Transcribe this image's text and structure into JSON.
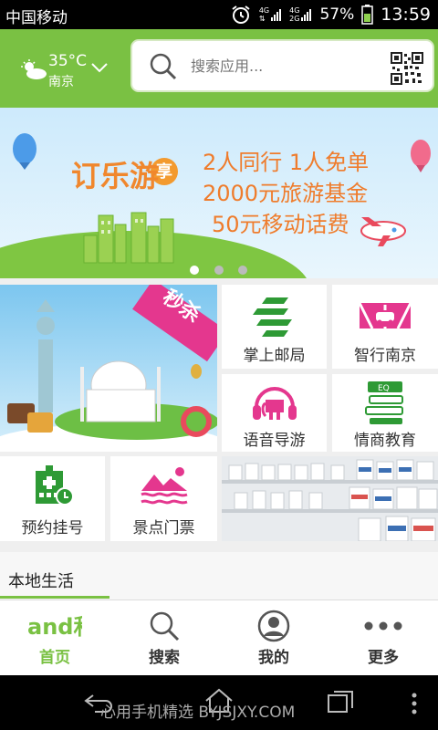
{
  "status_bar": {
    "carrier": "中国移动",
    "net1": "4G",
    "net2": "4G",
    "net3": "2G",
    "net4": "2G",
    "battery": "57%",
    "time": "13:59"
  },
  "weather": {
    "temperature": "35°C",
    "city": "南京"
  },
  "search": {
    "placeholder": "搜索应用..."
  },
  "banner": {
    "brand": "订乐游",
    "badge": "享",
    "line1": "2人同行 1人免单",
    "line2": "2000元旅游基金",
    "line3": "50元移动话费",
    "indicators": 3,
    "active_index": 0
  },
  "promo": {
    "tag": "秒杀"
  },
  "tiles": {
    "post": "掌上邮局",
    "traffic": "智行南京",
    "audio_guide": "语音导游",
    "education": "情商教育",
    "registration": "预约挂号",
    "tickets": "景点门票"
  },
  "section": {
    "title": "本地生活"
  },
  "bottom_nav": {
    "home": "首页",
    "search": "搜索",
    "mine": "我的",
    "more": "更多",
    "logo": "and和"
  },
  "watermark": "心用手机精选 BYJSJXY.COM",
  "colors": {
    "brand_green": "#7ac143",
    "pink": "#e4378e",
    "status_bar": "#000000"
  }
}
